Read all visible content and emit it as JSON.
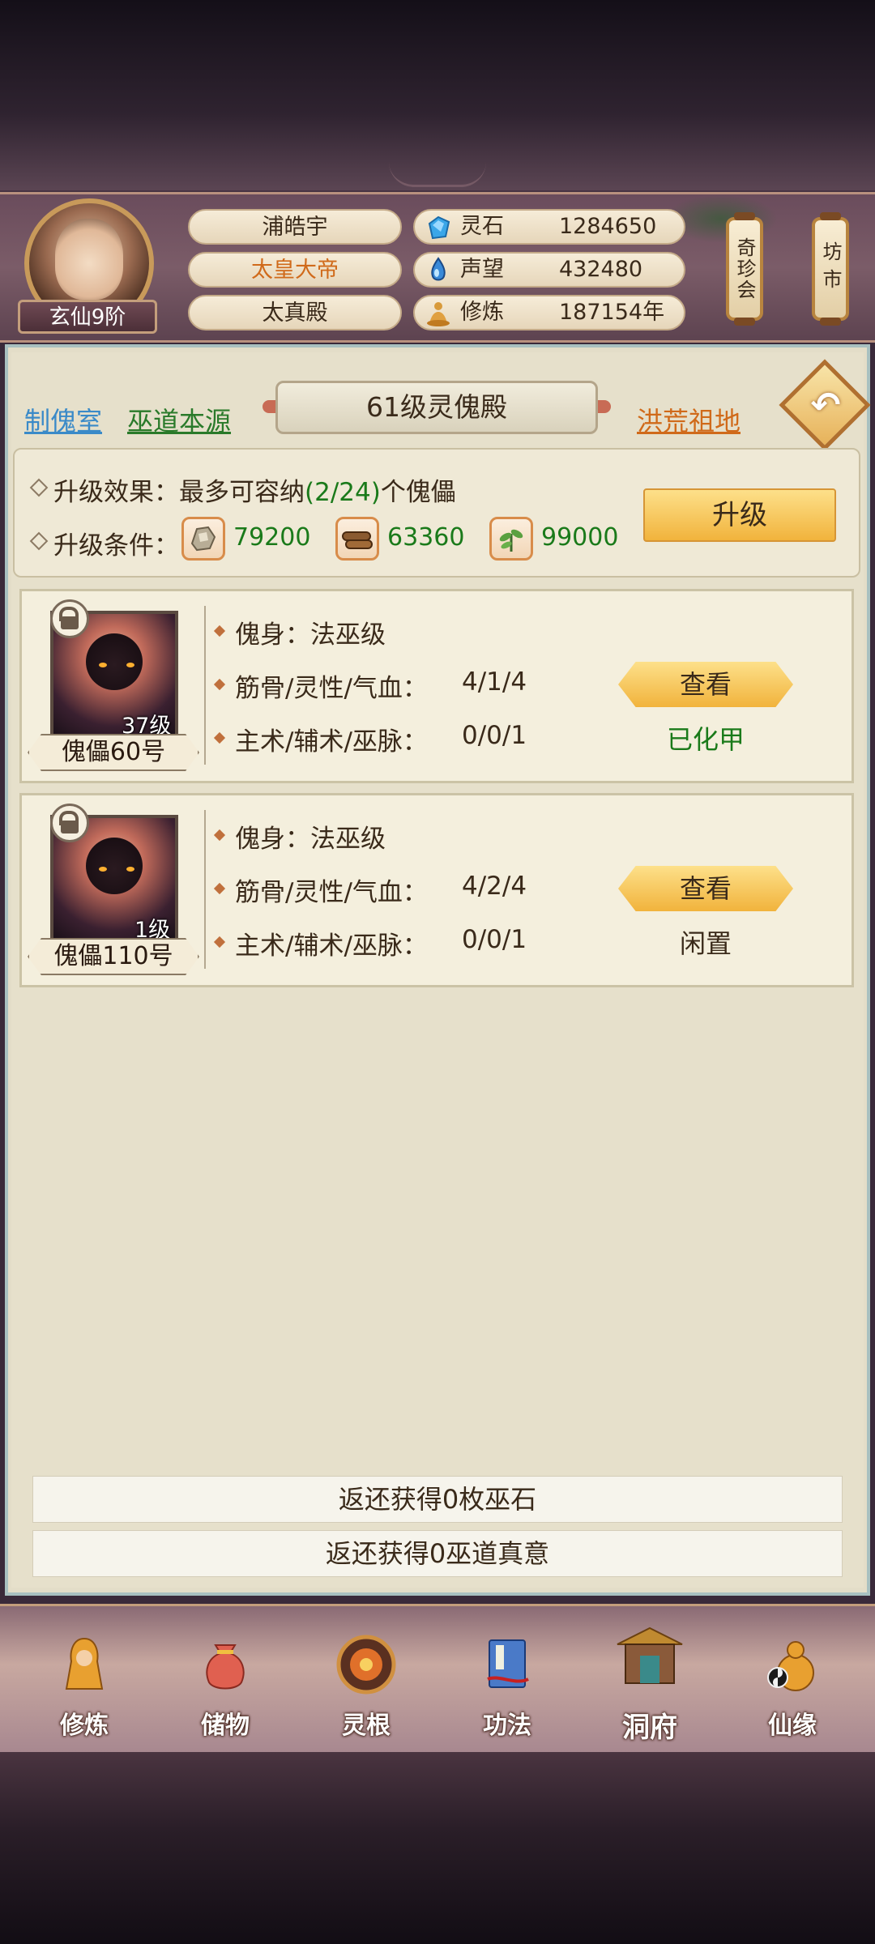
{
  "player": {
    "name": "浦皓宇",
    "title": "太皇大帝",
    "hall": "太真殿",
    "rank": "玄仙9阶"
  },
  "stats": [
    {
      "label": "灵石",
      "value": "1284650",
      "icon": "spirit-stone-icon"
    },
    {
      "label": "声望",
      "value": "432480",
      "icon": "reputation-icon"
    },
    {
      "label": "修炼",
      "value": "187154年",
      "icon": "meditation-icon"
    }
  ],
  "side_buttons": {
    "treasure": "奇珍会",
    "market": "坊市"
  },
  "nav_links": {
    "left1": "制傀室",
    "left2": "巫道本源",
    "title": "61级灵傀殿",
    "right": "洪荒祖地"
  },
  "upgrade": {
    "effect_label": "升级效果：",
    "effect_prefix": "最多可容纳",
    "effect_count": "(2/24)",
    "effect_suffix": "个傀儡",
    "cond_label": "升级条件：",
    "resources": [
      {
        "icon": "ore-icon",
        "value": "79200"
      },
      {
        "icon": "wood-logs-icon",
        "value": "63360"
      },
      {
        "icon": "herb-icon",
        "value": "99000"
      }
    ],
    "button": "升级"
  },
  "puppets": [
    {
      "name": "傀儡60号",
      "level": "37级",
      "body": "傀身：法巫级",
      "attr_label": "筋骨/灵性/气血：",
      "attr_value": "4/1/4",
      "skill_label": "主术/辅术/巫脉：",
      "skill_value": "0/0/1",
      "view": "查看",
      "status": "已化甲",
      "status_color": "#1a7a1a"
    },
    {
      "name": "傀儡110号",
      "level": "1级",
      "body": "傀身：法巫级",
      "attr_label": "筋骨/灵性/气血：",
      "attr_value": "4/2/4",
      "skill_label": "主术/辅术/巫脉：",
      "skill_value": "0/0/1",
      "view": "查看",
      "status": "闲置",
      "status_color": "#3a2a1a"
    }
  ],
  "refunds": [
    "返还获得0枚巫石",
    "返还获得0巫道真意"
  ],
  "bottom_nav": [
    {
      "label": "修炼",
      "icon": "cultivation-monk-icon"
    },
    {
      "label": "储物",
      "icon": "storage-bag-icon"
    },
    {
      "label": "灵根",
      "icon": "spirit-root-icon"
    },
    {
      "label": "功法",
      "icon": "skill-book-icon"
    },
    {
      "label": "洞府",
      "icon": "cave-mansion-icon"
    },
    {
      "label": "仙缘",
      "icon": "immortal-fate-icon"
    }
  ],
  "colors": {
    "link_blue": "#3a8ac8",
    "link_green": "#2a7a2a",
    "link_orange": "#d06a1a",
    "title_orange": "#d06a1a",
    "resource_green": "#1a7a1a"
  }
}
